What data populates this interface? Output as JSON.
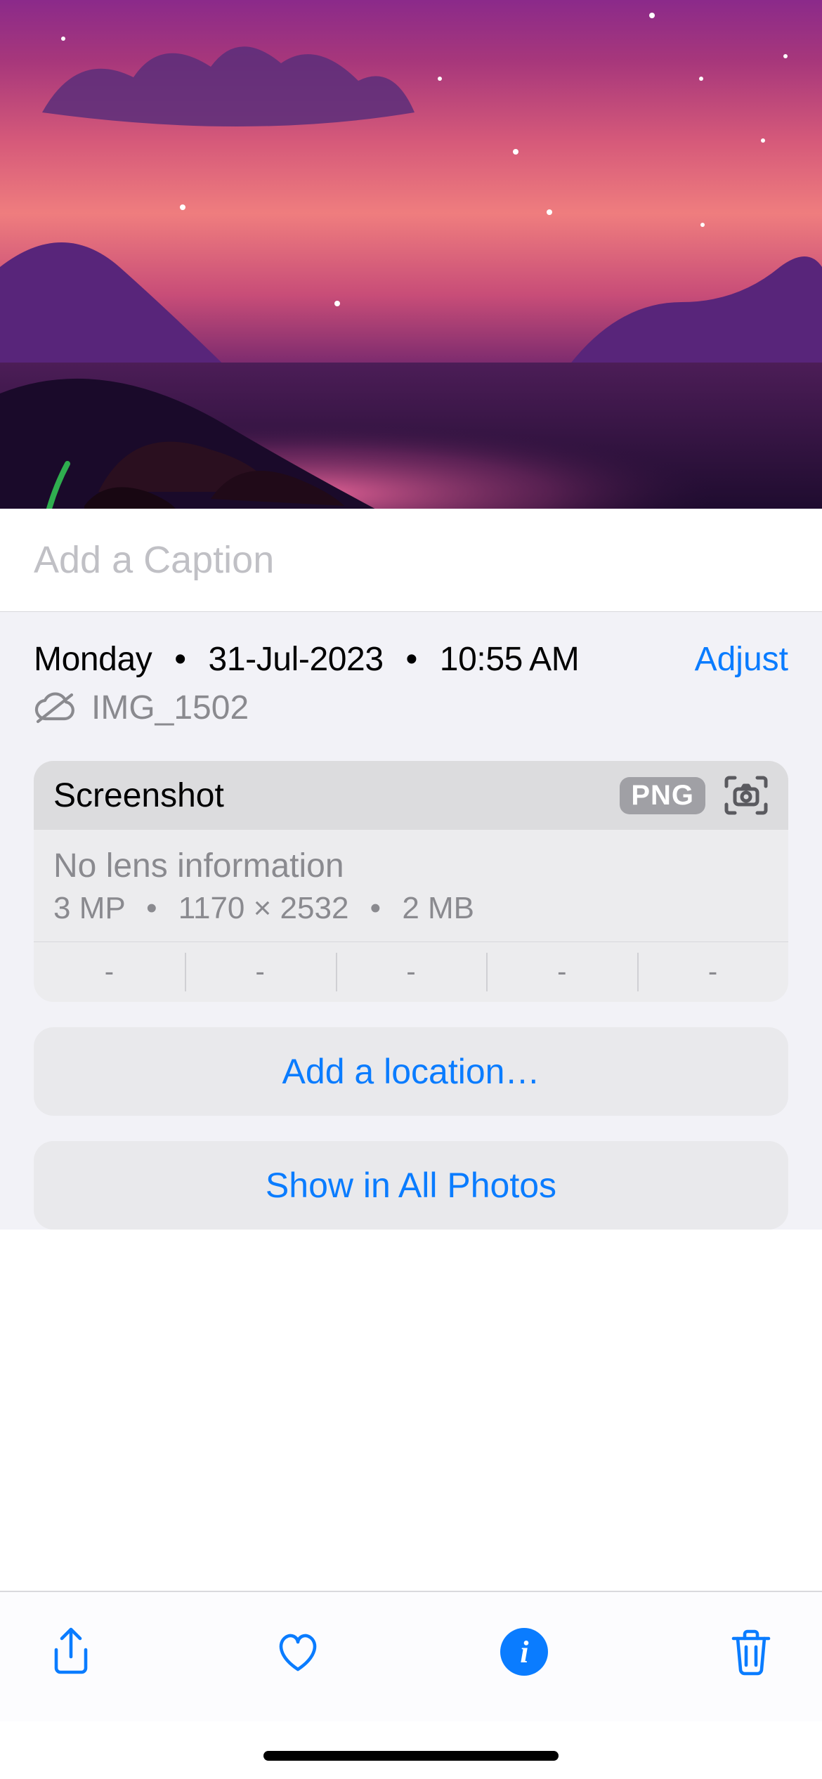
{
  "caption": {
    "placeholder": "Add a Caption",
    "value": ""
  },
  "date": {
    "weekday": "Monday",
    "date": "31-Jul-2023",
    "time": "10:55 AM",
    "adjust_label": "Adjust"
  },
  "file": {
    "name": "IMG_1502",
    "sync_icon": "cloud-off-icon"
  },
  "card": {
    "title": "Screenshot",
    "format_badge": "PNG",
    "glyph": "screenshot-icon",
    "lens_info": "No lens information",
    "megapixels": "3 MP",
    "dimensions": "1170 × 2532",
    "filesize": "2 MB",
    "exif": [
      "-",
      "-",
      "-",
      "-",
      "-"
    ]
  },
  "actions": {
    "add_location": "Add a location…",
    "show_all": "Show in All Photos"
  },
  "toolbar": {
    "share": "share-icon",
    "favorite": "heart-icon",
    "info": "info-icon",
    "delete": "trash-icon"
  },
  "accent_color": "#0a7cff"
}
